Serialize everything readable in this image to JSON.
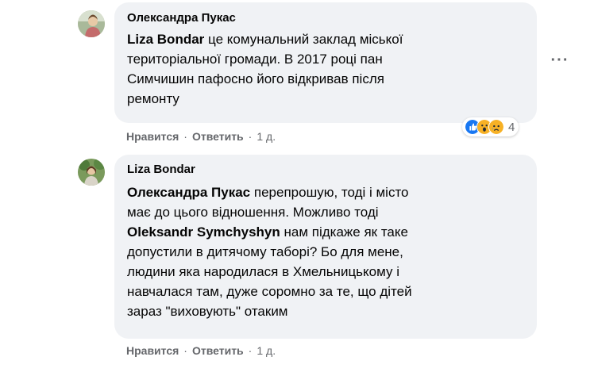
{
  "comments": [
    {
      "author": "Олександра Пукас",
      "lines": [
        [
          {
            "t": "Liza Bondar",
            "m": true
          },
          {
            "t": " це комунальний заклад міської",
            "m": false
          }
        ],
        [
          {
            "t": "територіальної громади. В 2017 році пан",
            "m": false
          }
        ],
        [
          {
            "t": "Симчишин пафосно його відкривав після",
            "m": false
          }
        ],
        [
          {
            "t": "ремонту",
            "m": false
          }
        ]
      ],
      "like_label": "Нравится",
      "reply_label": "Ответить",
      "time": "1 д.",
      "reaction_count": "4",
      "reactions": [
        "like-icon",
        "wow-icon",
        "sad-icon"
      ]
    },
    {
      "author": "Liza Bondar",
      "lines": [
        [
          {
            "t": "Олександра Пукас",
            "m": true
          },
          {
            "t": " перепрошую, тоді і місто",
            "m": false
          }
        ],
        [
          {
            "t": "має до цього відношення. Можливо тоді",
            "m": false
          }
        ],
        [
          {
            "t": "Oleksandr Symchyshyn",
            "m": true
          },
          {
            "t": " нам підкаже як таке",
            "m": false
          }
        ],
        [
          {
            "t": "допустили в дитячому таборі? Бо для мене,",
            "m": false
          }
        ],
        [
          {
            "t": "людини яка народилася в Хмельницькому і",
            "m": false
          }
        ],
        [
          {
            "t": "навчалася там, дуже соромно за те, що дітей",
            "m": false
          }
        ],
        [
          {
            "t": "зараз \"виховують\" отаким",
            "m": false
          }
        ]
      ],
      "like_label": "Нравится",
      "reply_label": "Ответить",
      "time": "1 д."
    }
  ],
  "more_label": "···",
  "colors": {
    "bubble": "#f0f2f5",
    "meta": "#65676b",
    "like": "#1877f2",
    "wow": "#f7b125"
  }
}
